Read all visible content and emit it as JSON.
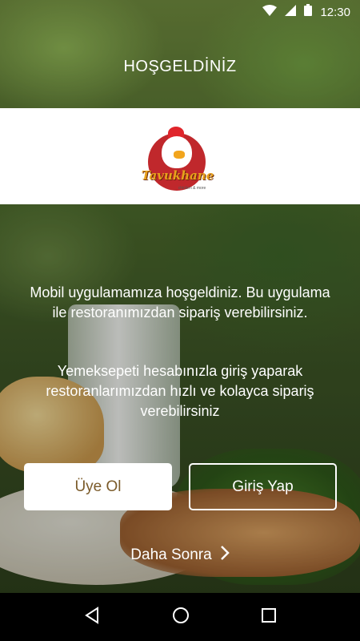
{
  "status_bar": {
    "time": "12:30"
  },
  "header": {
    "title": "HOŞGELDİNİZ"
  },
  "logo": {
    "name": "Tavukhane",
    "tagline": "chicken & more"
  },
  "welcome": {
    "message_1": "Mobil uygulamamıza hoşgeldiniz. Bu uygulama ile restoranımızdan sipariş verebilirsiniz.",
    "message_2": "Yemeksepeti hesabınızla giriş yaparak restoranlarımızdan hızlı ve kolayca sipariş verebilirsiniz"
  },
  "buttons": {
    "register": "Üye Ol",
    "login": "Giriş Yap"
  },
  "later": {
    "label": "Daha Sonra"
  },
  "colors": {
    "brand_red": "#c0282c",
    "brand_gold": "#e8a21c",
    "register_text": "#7b5b2a"
  },
  "icons": {
    "wifi": "wifi-icon",
    "signal": "signal-icon",
    "battery": "battery-icon",
    "chevron": "chevron-right-icon",
    "back": "back-icon",
    "home": "home-icon",
    "recents": "recents-icon"
  }
}
